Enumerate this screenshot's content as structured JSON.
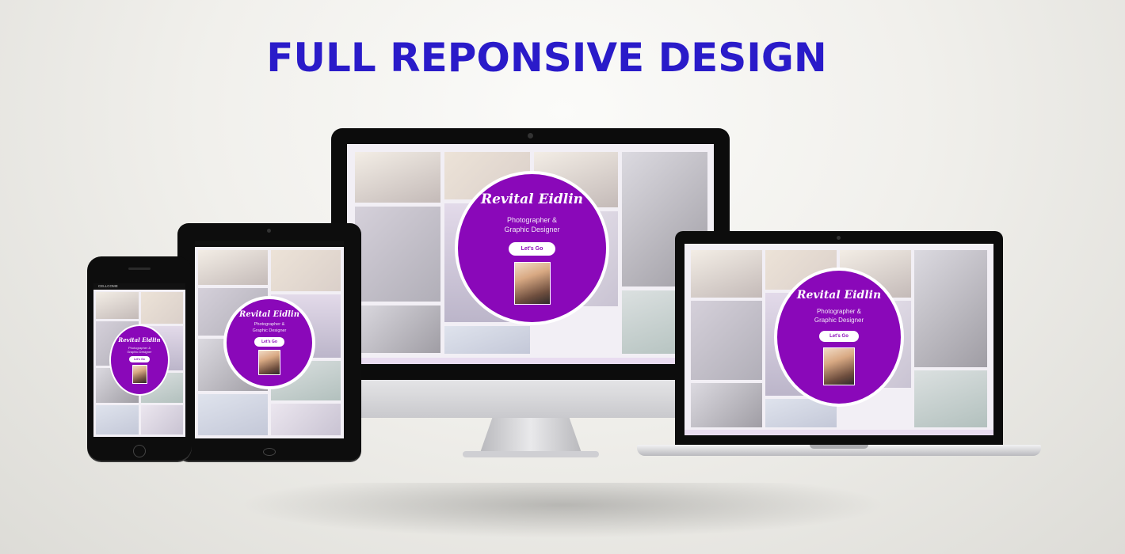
{
  "headline": "FULL REPONSIVE DESIGN",
  "site": {
    "name": "Revital Eidlin",
    "tagline_line1": "Photographer &",
    "tagline_line2": "Graphic Designer",
    "button": "Let's Go"
  },
  "phone_status": {
    "carrier": "CELLCOME"
  },
  "colors": {
    "headline": "#2a1bc9",
    "circle": "#8a08b9"
  }
}
